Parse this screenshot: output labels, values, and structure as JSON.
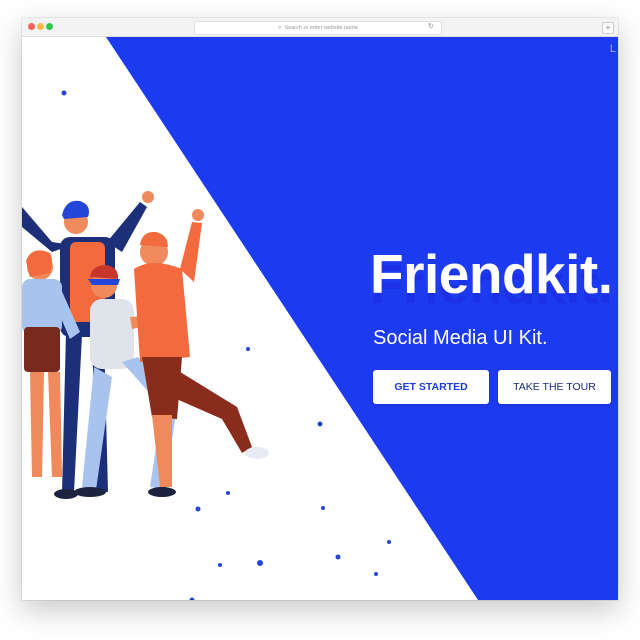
{
  "browser": {
    "address_placeholder": "Search or enter website name",
    "new_tab_label": "+"
  },
  "hero": {
    "title": "Friendkit.",
    "subtitle": "Social Media UI Kit.",
    "corner_link": "L",
    "buttons": {
      "get_started": "GET STARTED",
      "take_tour": "TAKE THE TOUR"
    }
  },
  "colors": {
    "brand_blue": "#1c3bf0",
    "button_text": "#1c3bd1",
    "skin": "#f08a5d",
    "hair_blue": "#2446d8",
    "shirt_orange": "#f26a3d"
  },
  "icons": [
    "search-icon",
    "reload-icon",
    "plus-icon"
  ]
}
